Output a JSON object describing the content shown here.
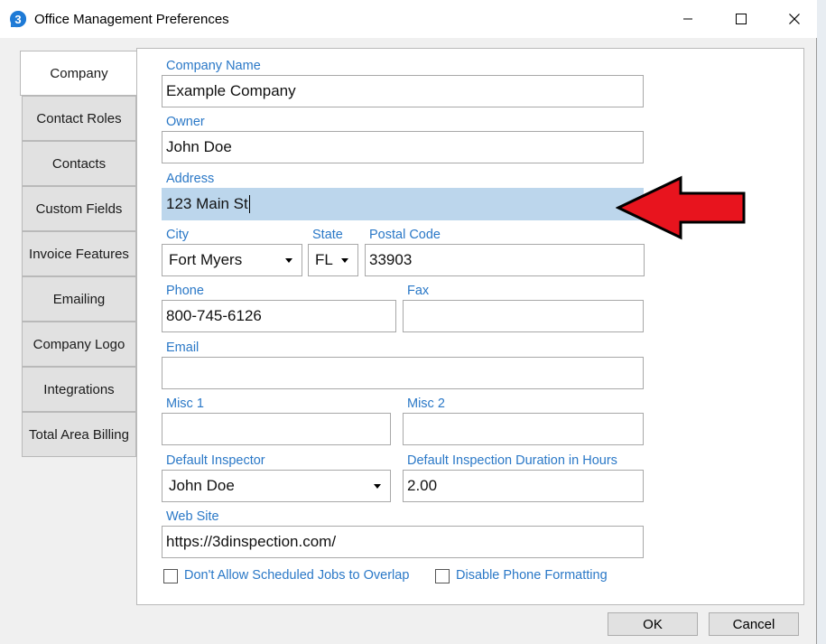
{
  "window": {
    "title": "Office Management Preferences",
    "controls": [
      "minimize-icon",
      "maximize-icon",
      "close-icon"
    ]
  },
  "tabs": [
    {
      "label": "Company",
      "active": true
    },
    {
      "label": "Contact Roles",
      "active": false
    },
    {
      "label": "Contacts",
      "active": false
    },
    {
      "label": "Custom Fields",
      "active": false
    },
    {
      "label": "Invoice Features",
      "active": false
    },
    {
      "label": "Emailing",
      "active": false
    },
    {
      "label": "Company Logo",
      "active": false
    },
    {
      "label": "Integrations",
      "active": false
    },
    {
      "label": "Total Area Billing",
      "active": false
    }
  ],
  "form": {
    "company_name": {
      "label": "Company Name",
      "value": "Example Company"
    },
    "owner": {
      "label": "Owner",
      "value": "John Doe"
    },
    "address": {
      "label": "Address",
      "value": "123 Main St"
    },
    "city": {
      "label": "City",
      "value": "Fort Myers"
    },
    "state": {
      "label": "State",
      "value": "FL"
    },
    "postal_code": {
      "label": "Postal Code",
      "value": "33903"
    },
    "phone": {
      "label": "Phone",
      "value": "800-745-6126"
    },
    "fax": {
      "label": "Fax",
      "value": ""
    },
    "email": {
      "label": "Email",
      "value": ""
    },
    "misc1": {
      "label": "Misc 1",
      "value": ""
    },
    "misc2": {
      "label": "Misc 2",
      "value": ""
    },
    "default_inspector": {
      "label": "Default Inspector",
      "value": "John Doe"
    },
    "default_duration": {
      "label": "Default Inspection Duration in Hours",
      "value": "2.00"
    },
    "website": {
      "label": "Web Site",
      "value": "https://3dinspection.com/"
    },
    "no_overlap": {
      "label": "Don't Allow Scheduled Jobs to Overlap",
      "checked": false
    },
    "disable_phone_format": {
      "label": "Disable Phone Formatting",
      "checked": false
    }
  },
  "buttons": {
    "ok": "OK",
    "cancel": "Cancel"
  },
  "colors": {
    "label_blue": "#2a78c7",
    "highlight": "#bcd6ec",
    "annotation_red": "#e8141e"
  }
}
